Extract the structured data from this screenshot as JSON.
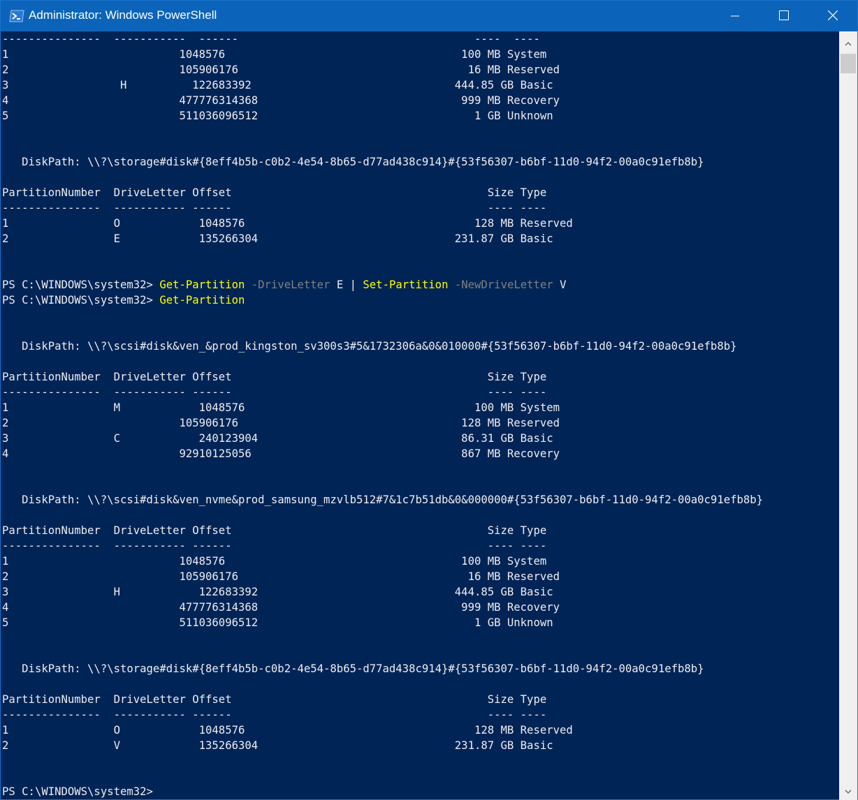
{
  "window": {
    "title": "Administrator: Windows PowerShell",
    "icon": "powershell-icon",
    "controls": [
      "minimize-icon",
      "maximize-icon",
      "close-icon"
    ]
  },
  "colors": {
    "console_bg": "#012456",
    "titlebar_bg": "#0c64ba",
    "command": "#ffff00",
    "parameter": "#808080",
    "text": "#eeedf0"
  },
  "console": {
    "lines": [
      [
        {
          "t": "---------------  -----------  ------                                    ----  ----"
        }
      ],
      [
        {
          "t": "1                          1048576                                    100 MB System"
        }
      ],
      [
        {
          "t": "2                          105906176                                   16 MB Reserved"
        }
      ],
      [
        {
          "t": "3                 H          122683392                               444.85 GB Basic"
        }
      ],
      [
        {
          "t": "4                          477776314368                               999 MB Recovery"
        }
      ],
      [
        {
          "t": "5                          511036096512                                 1 GB Unknown"
        }
      ],
      [
        {
          "t": ""
        }
      ],
      [
        {
          "t": ""
        }
      ],
      [
        {
          "t": "   DiskPath: \\\\?\\storage#disk#{8eff4b5b-c0b2-4e54-8b65-d77ad438c914}#{53f56307-b6bf-11d0-94f2-00a0c91efb8b}"
        }
      ],
      [
        {
          "t": ""
        }
      ],
      [
        {
          "t": "PartitionNumber  DriveLetter Offset                                       Size Type"
        }
      ],
      [
        {
          "t": "---------------  ----------- ------                                       ---- ----"
        }
      ],
      [
        {
          "t": "1                O            1048576                                   128 MB Reserved"
        }
      ],
      [
        {
          "t": "2                E            135266304                              231.87 GB Basic"
        }
      ],
      [
        {
          "t": ""
        }
      ],
      [
        {
          "t": ""
        }
      ],
      [
        {
          "t": "PS C:\\WINDOWS\\system32> "
        },
        {
          "t": "Get-Partition",
          "c": "cmd"
        },
        {
          "t": " -DriveLetter",
          "c": "par"
        },
        {
          "t": " E | "
        },
        {
          "t": "Set-Partition",
          "c": "cmd"
        },
        {
          "t": " -NewDriveLetter",
          "c": "par"
        },
        {
          "t": " V"
        }
      ],
      [
        {
          "t": "PS C:\\WINDOWS\\system32> "
        },
        {
          "t": "Get-Partition",
          "c": "cmd"
        }
      ],
      [
        {
          "t": ""
        }
      ],
      [
        {
          "t": ""
        }
      ],
      [
        {
          "t": "   DiskPath: \\\\?\\scsi#disk&ven_&prod_kingston_sv300s3#5&1732306a&0&010000#{53f56307-b6bf-11d0-94f2-00a0c91efb8b}"
        }
      ],
      [
        {
          "t": ""
        }
      ],
      [
        {
          "t": "PartitionNumber  DriveLetter Offset                                       Size Type"
        }
      ],
      [
        {
          "t": "---------------  ----------- ------                                       ---- ----"
        }
      ],
      [
        {
          "t": "1                M            1048576                                   100 MB System"
        }
      ],
      [
        {
          "t": "2                          105906176                                  128 MB Reserved"
        }
      ],
      [
        {
          "t": "3                C            240123904                               86.31 GB Basic"
        }
      ],
      [
        {
          "t": "4                          92910125056                                867 MB Recovery"
        }
      ],
      [
        {
          "t": ""
        }
      ],
      [
        {
          "t": ""
        }
      ],
      [
        {
          "t": "   DiskPath: \\\\?\\scsi#disk&ven_nvme&prod_samsung_mzvlb512#7&1c7b51db&0&000000#{53f56307-b6bf-11d0-94f2-00a0c91efb8b}"
        }
      ],
      [
        {
          "t": ""
        }
      ],
      [
        {
          "t": "PartitionNumber  DriveLetter Offset                                       Size Type"
        }
      ],
      [
        {
          "t": "---------------  ----------- ------                                       ---- ----"
        }
      ],
      [
        {
          "t": "1                          1048576                                    100 MB System"
        }
      ],
      [
        {
          "t": "2                          105906176                                   16 MB Reserved"
        }
      ],
      [
        {
          "t": "3                H            122683392                              444.85 GB Basic"
        }
      ],
      [
        {
          "t": "4                          477776314368                               999 MB Recovery"
        }
      ],
      [
        {
          "t": "5                          511036096512                                 1 GB Unknown"
        }
      ],
      [
        {
          "t": ""
        }
      ],
      [
        {
          "t": ""
        }
      ],
      [
        {
          "t": "   DiskPath: \\\\?\\storage#disk#{8eff4b5b-c0b2-4e54-8b65-d77ad438c914}#{53f56307-b6bf-11d0-94f2-00a0c91efb8b}"
        }
      ],
      [
        {
          "t": ""
        }
      ],
      [
        {
          "t": "PartitionNumber  DriveLetter Offset                                       Size Type"
        }
      ],
      [
        {
          "t": "---------------  ----------- ------                                       ---- ----"
        }
      ],
      [
        {
          "t": "1                O            1048576                                   128 MB Reserved"
        }
      ],
      [
        {
          "t": "2                V            135266304                              231.87 GB Basic"
        }
      ],
      [
        {
          "t": ""
        }
      ],
      [
        {
          "t": ""
        }
      ],
      [
        {
          "t": "PS C:\\WINDOWS\\system32> "
        }
      ]
    ]
  },
  "scrollbar": {
    "up_icon": "scroll-up-arrow-icon",
    "down_icon": "scroll-down-arrow-icon"
  }
}
